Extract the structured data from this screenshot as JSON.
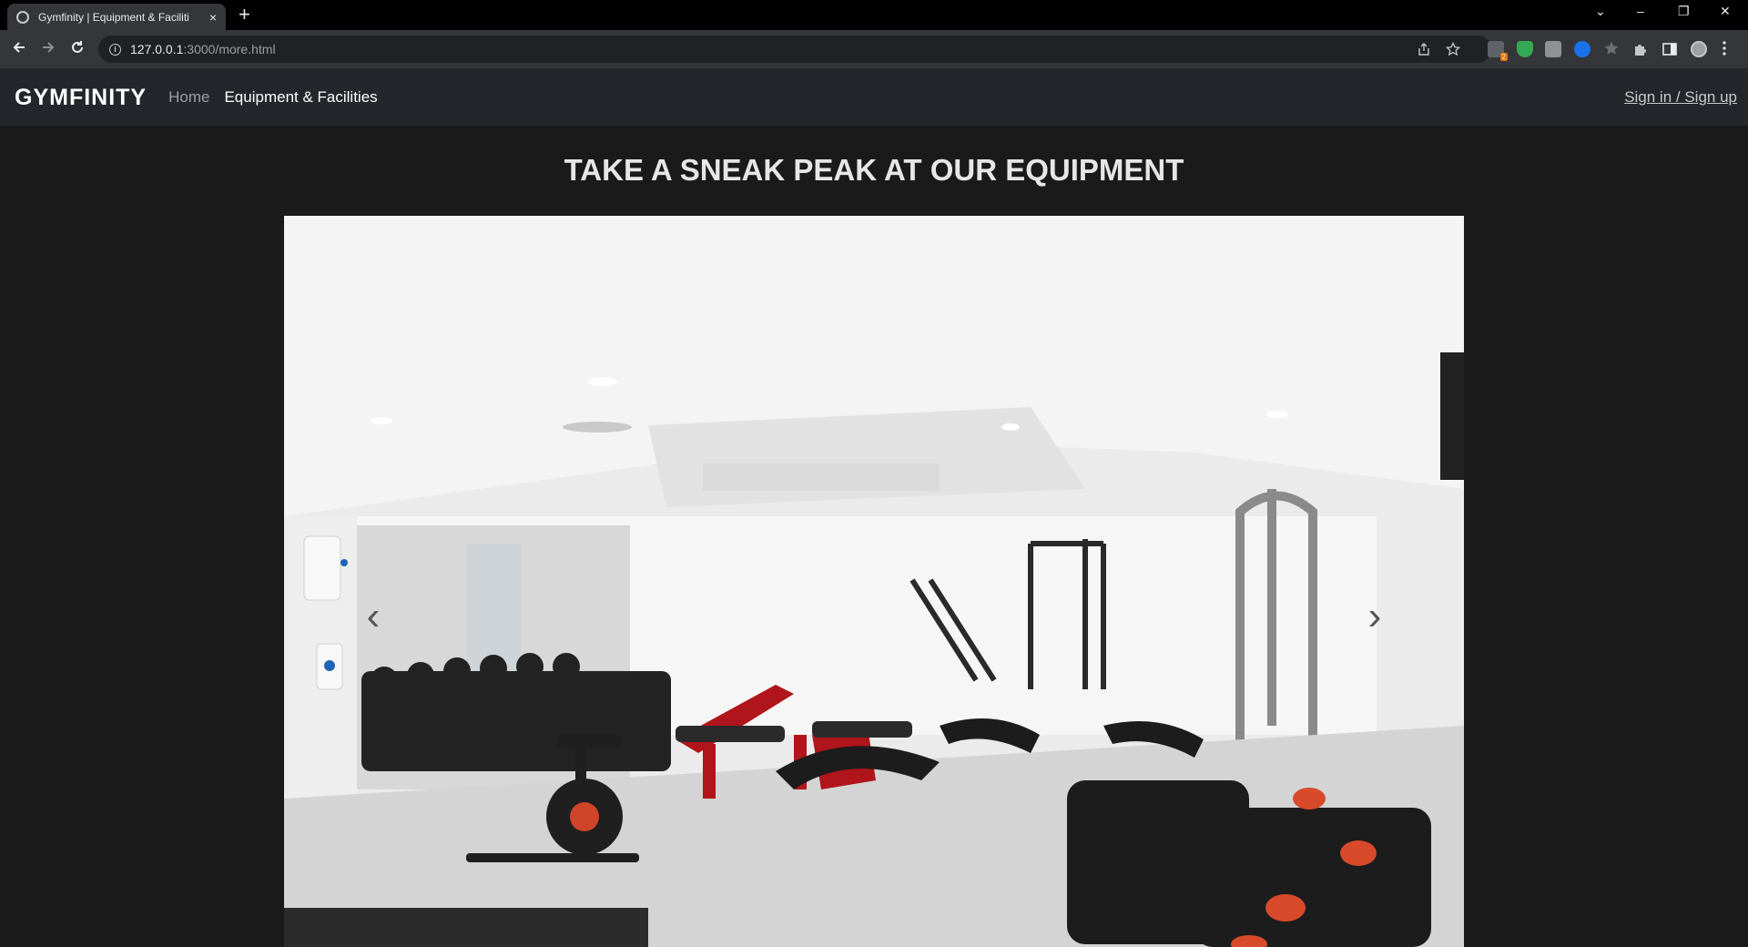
{
  "browser": {
    "tab_title": "Gymfinity | Equipment & Faciliti",
    "close_glyph": "×",
    "new_tab_glyph": "+",
    "url_host": "127.0.0.1",
    "url_path": ":3000/more.html",
    "extension_badge": "2",
    "window_controls": {
      "tab_search": "⌄",
      "minimize": "–",
      "restore": "❐",
      "close": "✕"
    }
  },
  "navbar": {
    "brand": "GYMFINITY",
    "links": [
      "Home",
      "Equipment & Facilities"
    ],
    "signin": "Sign in / Sign up"
  },
  "main": {
    "heading": "TAKE A SNEAK PEAK AT OUR EQUIPMENT",
    "carousel": {
      "prev_glyph": "‹",
      "next_glyph": "›"
    }
  },
  "colors": {
    "page_bg": "#1a1a1a",
    "navbar_bg": "#23272b",
    "tabstrip_bg": "#000000",
    "toolbar_bg": "#35363a",
    "accent_red": "#b0151b"
  }
}
